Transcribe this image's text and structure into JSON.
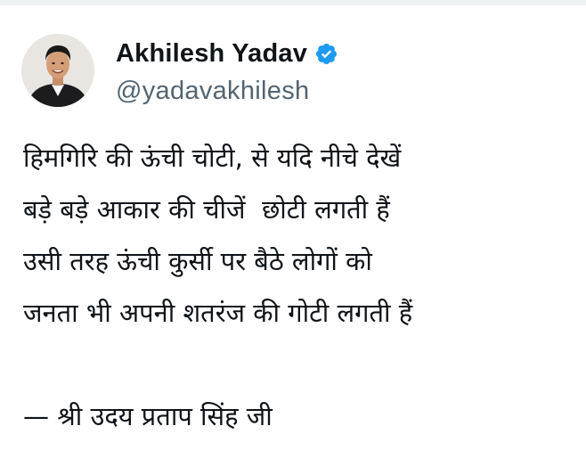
{
  "tweet": {
    "author": {
      "display_name": "Akhilesh Yadav",
      "handle": "@yadavakhilesh",
      "verified": true,
      "avatar_icon": "profile-photo",
      "verified_icon": "verified-badge-icon"
    },
    "lines": [
      "हिमगिरि की ऊंची चोटी, से यदि नीचे देखें",
      "बड़े बड़े आकार की चीजें  छोटी लगती हैं",
      "उसी तरह ऊंची कुर्सी पर बैठे लोगों को",
      "जनता भी अपनी शतरंज की गोटी लगती हैं",
      "",
      "— श्री उदय प्रताप सिंह जी"
    ]
  },
  "colors": {
    "text": "#0f1419",
    "secondary_text": "#536471",
    "verified_blue": "#1d9bf0",
    "divider": "#eff3f4"
  }
}
